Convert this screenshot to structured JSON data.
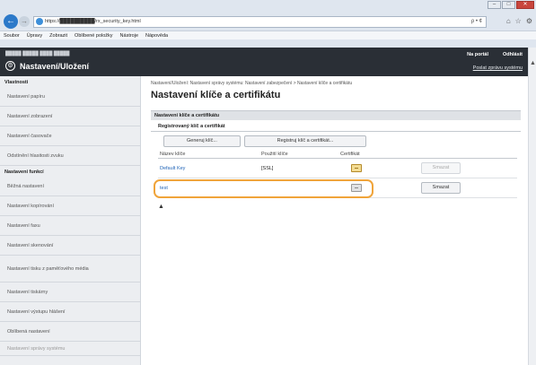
{
  "browser": {
    "address": "https://██████████/rx_security_key.html",
    "address_tools": "ρ • ¢",
    "nav_icons": [
      "⌂",
      "☆",
      "⚙"
    ],
    "window_buttons": [
      "–",
      "□",
      "✕"
    ],
    "menu": [
      "Soubor",
      "Úpravy",
      "Zobrazit",
      "Oblíbené položky",
      "Nástroje",
      "Nápověda"
    ]
  },
  "header": {
    "brand": "█████ █████ ████ █████",
    "title": "Nastavení/Uložení",
    "portal": "Na portál",
    "logout": "Odhlásit",
    "mail": "Poslat zprávu systému"
  },
  "sidebar": {
    "section1": "Vlastnosti",
    "items1": [
      "Nastavení papíru",
      "Nastavení zobrazení",
      "Nastavení časovače",
      "Odstínění hlasitosti zvuku"
    ],
    "section2": "Nastavení funkcí",
    "items2": [
      "Běžná nastavení",
      "Nastavení kopírování",
      "Nastavení faxu",
      "Nastavení skenování",
      "Nastavení tisku z paměťového média",
      "Nastavení tiskárny",
      "Nastavení výstupu hlášení",
      "Oblíbená nastavení",
      "Nastavení správy systému"
    ]
  },
  "main": {
    "breadcrumb": "Nastavení/Uložení: Nastavení správy systému: Nastavení zabezpečení > Nastavení klíče a certifikátu",
    "title": "Nastavení klíče a certifikátu",
    "section": "Nastavení klíče a certifikátu",
    "subsection": "Registrovaný klíč a certifikát",
    "generate_btn": "Generuj klíč...",
    "register_btn": "Registruj klíč a certifikát...",
    "columns": [
      "Název klíče",
      "Použití klíče",
      "Certifikát",
      ""
    ],
    "rows": [
      {
        "name": "Default Key",
        "usage": "[SSL]",
        "delete": "Smazat",
        "delete_enabled": false,
        "highlighted": false
      },
      {
        "name": "test",
        "usage": "",
        "delete": "Smazat",
        "delete_enabled": true,
        "highlighted": true
      }
    ],
    "top_arrow": "▲"
  }
}
